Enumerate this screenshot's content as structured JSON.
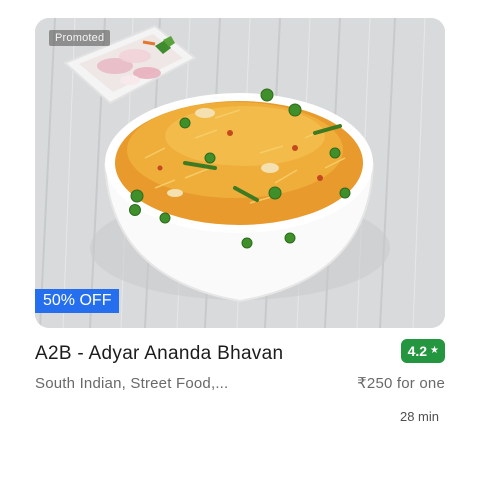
{
  "restaurant": {
    "promoted_label": "Promoted",
    "offer_label": "50% OFF",
    "name": "A2B - Adyar Ananda Bhavan",
    "rating": "4.2",
    "rating_star_icon": "star-icon",
    "cuisines": "South Indian, Street Food,...",
    "price_for_one": "₹250 for one",
    "delivery_time": "28 min"
  },
  "colors": {
    "rating_bg": "#24963f",
    "offer_bg": "#256fef",
    "title": "#1c1c1c",
    "subtext": "#696969"
  }
}
